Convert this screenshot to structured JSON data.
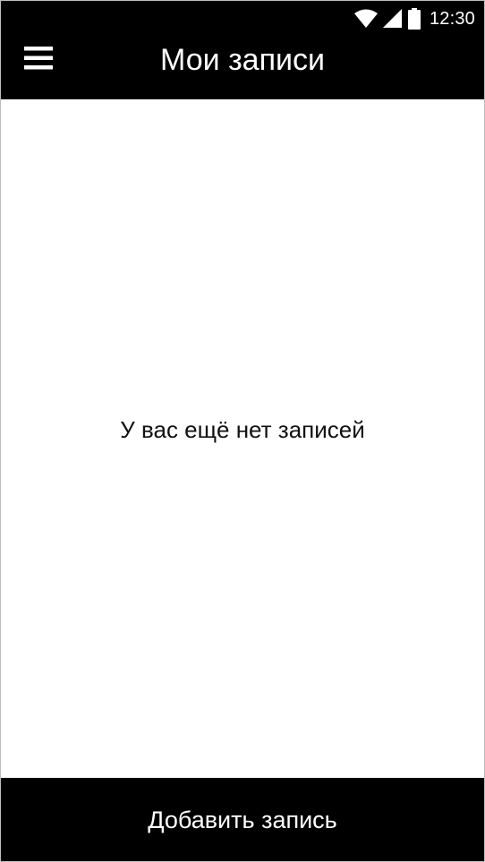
{
  "status_bar": {
    "time": "12:30",
    "icons": [
      "wifi-icon",
      "cellular-signal-icon",
      "battery-icon"
    ]
  },
  "header": {
    "menu_icon": "hamburger-menu-icon",
    "title": "Мои записи"
  },
  "main": {
    "empty_message": "У вас ещё нет записей"
  },
  "footer": {
    "add_button_label": "Добавить запись"
  },
  "colors": {
    "appbar_bg": "#000000",
    "appbar_text": "#ffffff",
    "content_bg": "#ffffff",
    "content_text": "#111111"
  }
}
